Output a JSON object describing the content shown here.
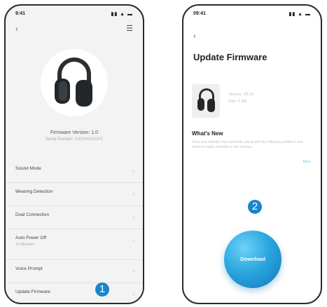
{
  "left_screen": {
    "status_time": "9:41",
    "status_icons": "▮▮ ▲ ▬",
    "back_icon": "‹",
    "top_right_icon": "☰",
    "device_name": "Firmware Version: 1.0",
    "device_sub": "Serial Number: XXXXXXXXXX",
    "menu": [
      {
        "label": "Sound Mode"
      },
      {
        "label": "Wearing Detection"
      },
      {
        "label": "Dual Connection"
      },
      {
        "label": "Auto Power Off",
        "sub": "10 Minutes"
      },
      {
        "label": "Voice Prompt"
      },
      {
        "label": "Update Firmware"
      }
    ],
    "chevron": "›",
    "step_badge": "1"
  },
  "right_screen": {
    "status_time": "09:41",
    "status_icons": "▮▮ ▲ ▬",
    "back_icon": "‹",
    "title": "Update Firmware",
    "fw_line1": "Version: V0.13",
    "fw_line2": "Size: 1.3M",
    "whats_new_title": "What's New",
    "whats_new_text": "Fixes and stability improvements, along with the following additions and features made available in this release.",
    "more_link": "More",
    "download_label": "Download",
    "step_badge": "2"
  },
  "colors": {
    "accent": "#1a85c9",
    "download_gradient_start": "#6fd1f5",
    "download_gradient_end": "#1577b8"
  }
}
